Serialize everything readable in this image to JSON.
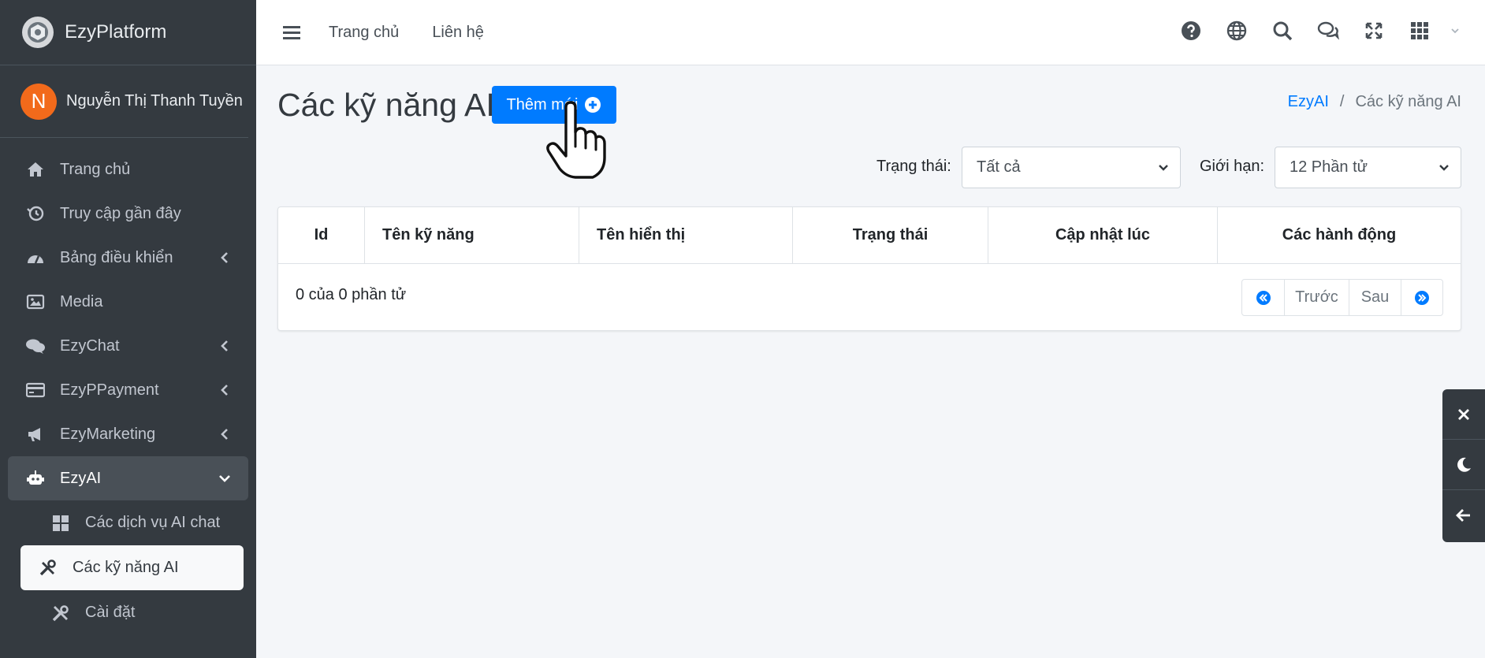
{
  "brand": {
    "name": "EzyPlatform"
  },
  "user": {
    "initial": "N",
    "name": "Nguyễn Thị Thanh Tuyền"
  },
  "sidebar": {
    "items": [
      {
        "label": "Trang chủ",
        "icon": "home-icon"
      },
      {
        "label": "Truy cập gần đây",
        "icon": "history-icon"
      },
      {
        "label": "Bảng điều khiển",
        "icon": "dashboard-icon"
      },
      {
        "label": "Media",
        "icon": "image-icon"
      },
      {
        "label": "EzyChat",
        "icon": "comments-icon"
      },
      {
        "label": "EzyPPayment",
        "icon": "credit-card-icon"
      },
      {
        "label": "EzyMarketing",
        "icon": "bullhorn-icon"
      },
      {
        "label": "EzyAI",
        "icon": "robot-icon"
      }
    ],
    "subitems": [
      {
        "label": "Các dịch vụ AI chat",
        "icon": "grid-icon"
      },
      {
        "label": "Các kỹ năng AI",
        "icon": "tools-icon"
      },
      {
        "label": "Cài đặt",
        "icon": "wrench-icon"
      }
    ]
  },
  "topbar": {
    "links": [
      "Trang chủ",
      "Liên hệ"
    ]
  },
  "page": {
    "title": "Các kỹ năng AI",
    "add_button": "Thêm mới"
  },
  "breadcrumb": {
    "root": "EzyAI",
    "current": "Các kỹ năng AI"
  },
  "filters": {
    "status_label": "Trạng thái:",
    "status_value": "Tất cả",
    "limit_label": "Giới hạn:",
    "limit_value": "12 Phần tử"
  },
  "table": {
    "columns": [
      "Id",
      "Tên kỹ năng",
      "Tên hiển thị",
      "Trạng thái",
      "Cập nhật lúc",
      "Các hành động"
    ],
    "info": "0 của 0 phần tử"
  },
  "pagination": {
    "prev": "Trước",
    "next": "Sau"
  },
  "colors": {
    "primary": "#007bff",
    "sidebar": "#343a40",
    "avatar": "#f26a1b"
  }
}
